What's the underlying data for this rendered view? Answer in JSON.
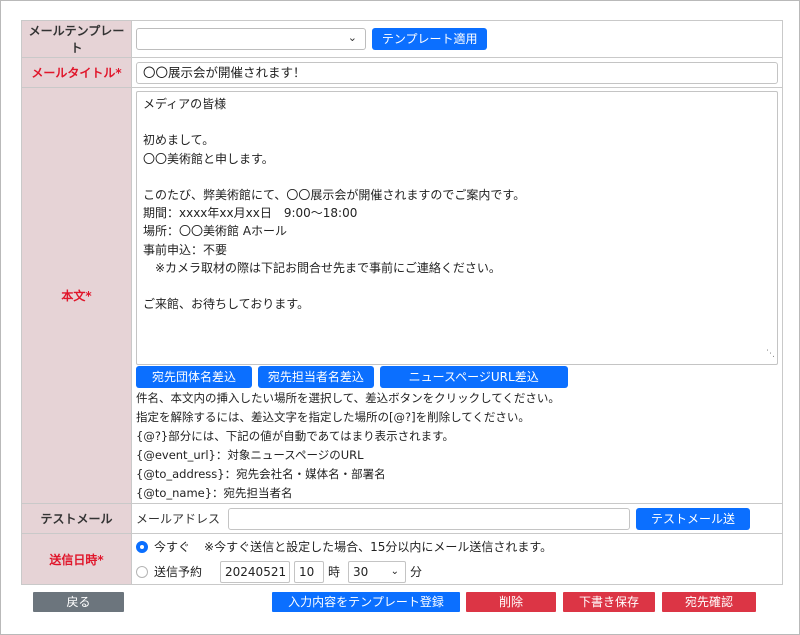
{
  "form": {
    "template_label": "メールテンプレート",
    "template_select_value": "",
    "template_apply_button": "テンプレート適用",
    "title_label": "メールタイトル*",
    "title_value": "〇〇展示会が開催されます！",
    "body_label": "本文*",
    "body_text": "メディアの皆様\n\n初めまして。\n〇〇美術館と申します。\n\nこのたび、弊美術館にて、〇〇展示会が開催されますのでご案内です。\n期間：xxxx年xx月xx日　9:00〜18:00\n場所：〇〇美術館 Aホール\n事前申込：不要\n　※カメラ取材の際は下記お問合せ先まで事前にご連絡ください。\n\nご来館、お待ちしております。",
    "insert_buttons": [
      "宛先団体名差込",
      "宛先担当者名差込",
      "ニュースページURL差込"
    ],
    "help_lines": [
      "件名、本文内の挿入したい場所を選択して、差込ボタンをクリックしてください。",
      "指定を解除するには、差込文字を指定した場所の[@?]を削除してください。",
      "{@?}部分には、下記の値が自動であてはまり表示されます。",
      "{@event_url}：対象ニュースページのURL",
      "{@to_address}：宛先会社名・媒体名・部署名",
      "{@to_name}：宛先担当者名"
    ],
    "test_label": "テストメール",
    "test_address_label": "メールアドレス",
    "test_address_value": "",
    "test_send_button": "テストメール送信",
    "send_label": "送信日時*",
    "send_now_label": "今すぐ",
    "send_now_note": "※今すぐ送信と設定した場合、15分以内にメール送信されます。",
    "send_now_checked": true,
    "send_scheduled_label": "送信予約",
    "schedule_date": "20240521",
    "schedule_hour": "10",
    "hour_unit": "時",
    "schedule_minute": "30",
    "minute_unit": "分"
  },
  "actions": {
    "back": "戻る",
    "register_template": "入力内容をテンプレート登録",
    "delete": "削除",
    "save_draft": "下書き保存",
    "confirm_recipients": "宛先確認"
  },
  "colors": {
    "primary": "#0b6fff",
    "danger": "#dc3545",
    "secondary": "#6c757d",
    "label_bg": "#e6d3d6",
    "required_text": "#e0162b"
  }
}
